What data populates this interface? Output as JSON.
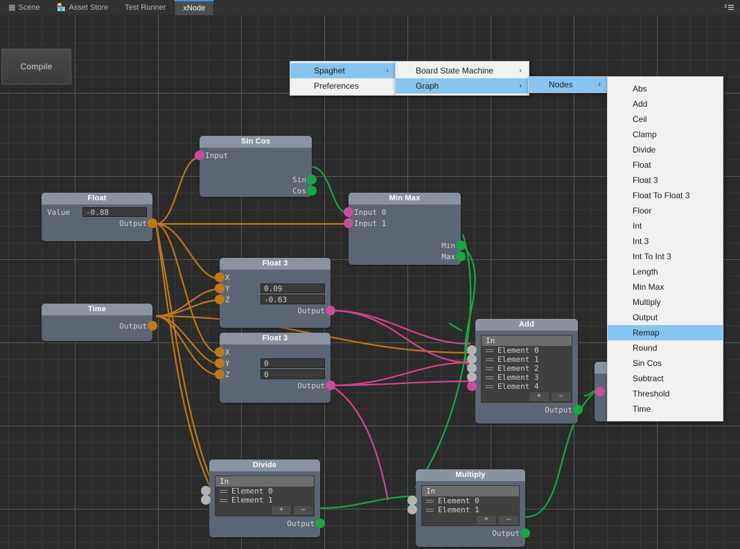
{
  "tabs": [
    {
      "label": "Scene",
      "icon": "grid-icon",
      "active": false
    },
    {
      "label": "Asset Store",
      "icon": "store-icon",
      "active": false
    },
    {
      "label": "Test Runner",
      "icon": "",
      "active": false
    },
    {
      "label": "xNode",
      "icon": "",
      "active": true
    }
  ],
  "tabbar": {
    "menu_icon": "hamburger-menu-icon"
  },
  "toolbar": {
    "compile_label": "Compile"
  },
  "context_menu": {
    "level1": [
      {
        "label": "Spaghet",
        "selected": true,
        "submenu": true
      },
      {
        "label": "Preferences",
        "selected": false,
        "submenu": false
      }
    ],
    "level2": [
      {
        "label": "Board State Machine",
        "selected": false,
        "submenu": true
      },
      {
        "label": "Graph",
        "selected": true,
        "submenu": true
      }
    ],
    "level3": [
      {
        "label": "Nodes",
        "selected": true,
        "submenu": true
      }
    ],
    "level4": [
      {
        "label": "Abs",
        "selected": false
      },
      {
        "label": "Add",
        "selected": false
      },
      {
        "label": "Ceil",
        "selected": false
      },
      {
        "label": "Clamp",
        "selected": false
      },
      {
        "label": "Divide",
        "selected": false
      },
      {
        "label": "Float",
        "selected": false
      },
      {
        "label": "Float 3",
        "selected": false
      },
      {
        "label": "Float To Float 3",
        "selected": false
      },
      {
        "label": "Floor",
        "selected": false
      },
      {
        "label": "Int",
        "selected": false
      },
      {
        "label": "Int 3",
        "selected": false
      },
      {
        "label": "Int To Int 3",
        "selected": false
      },
      {
        "label": "Length",
        "selected": false
      },
      {
        "label": "Min Max",
        "selected": false
      },
      {
        "label": "Multiply",
        "selected": false
      },
      {
        "label": "Output",
        "selected": false
      },
      {
        "label": "Remap",
        "selected": true
      },
      {
        "label": "Round",
        "selected": false
      },
      {
        "label": "Sin Cos",
        "selected": false
      },
      {
        "label": "Subtract",
        "selected": false
      },
      {
        "label": "Threshold",
        "selected": false
      },
      {
        "label": "Time",
        "selected": false
      }
    ]
  },
  "nodes": {
    "sincos": {
      "title": "Sin Cos",
      "in0": "Input",
      "out0": "Sin",
      "out1": "Cos"
    },
    "float": {
      "title": "Float",
      "value_label": "Value",
      "value": "-0.88",
      "out0": "Output"
    },
    "minmax": {
      "title": "Min Max",
      "in0": "Input 0",
      "in1": "Input 1",
      "out0": "Min",
      "out1": "Max"
    },
    "time": {
      "title": "Time",
      "out0": "Output"
    },
    "float3a": {
      "title": "Float 3",
      "x": "X",
      "y": "Y",
      "z": "Z",
      "y_value": "0.09",
      "z_value": "-0.63",
      "out0": "Output"
    },
    "float3b": {
      "title": "Float 3",
      "x": "X",
      "y": "Y",
      "z": "Z",
      "y_value": "0",
      "z_value": "0",
      "out0": "Output"
    },
    "add": {
      "title": "Add",
      "list_header": "In",
      "items": [
        "Element 0",
        "Element 1",
        "Element 2",
        "Element 3",
        "Element 4"
      ],
      "add_btn": "+",
      "remove_btn": "–",
      "out0": "Output"
    },
    "divide": {
      "title": "Divide",
      "list_header": "In",
      "items": [
        "Element 0",
        "Element 1"
      ],
      "add_btn": "+",
      "remove_btn": "–",
      "out0": "Output"
    },
    "multiply": {
      "title": "Multiply",
      "list_header": "In",
      "items": [
        "Element 0",
        "Element 1"
      ],
      "add_btn": "+",
      "remove_btn": "–",
      "out0": "Output"
    }
  },
  "colors": {
    "canvas_bg": "#2b2b2b",
    "grid_minor": "#383838",
    "grid_major": "#585858",
    "node_body": "#5c6573",
    "node_header": "#8b93a1",
    "port_float": "#c07818",
    "port_float3": "#c84f9c",
    "port_out_green": "#17a845",
    "port_unconnected": "#b3b3b3",
    "menu_highlight": "#86c5f0",
    "tab_active": "#4c4c4c",
    "tab_accent": "#4a8fd4"
  }
}
